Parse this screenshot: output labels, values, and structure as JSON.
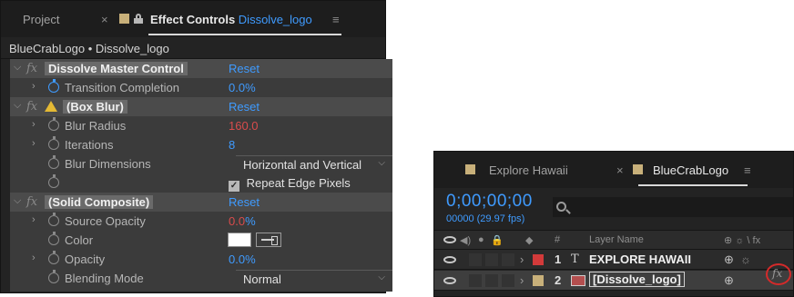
{
  "effect_controls": {
    "tab_project": "Project",
    "tab_close": "×",
    "tab_title_prefix": "Effect Controls",
    "tab_title_layer": "Dissolve_logo",
    "menu_icon": "≡",
    "breadcrumb": "BlueCrabLogo • Dissolve_logo",
    "colors": {
      "accent": "#3f9bff",
      "red_value": "#d94c4c",
      "panel": "#3b3b3b",
      "fx_row": "#4b4b4b"
    },
    "effects": [
      {
        "name": "Dissolve Master Control",
        "reset": "Reset",
        "properties": [
          {
            "name": "Transition Completion",
            "value": "0.0%",
            "stopwatch_active": true
          }
        ]
      },
      {
        "name": "(Box Blur)",
        "reset": "Reset",
        "warning": true,
        "properties": [
          {
            "name": "Blur Radius",
            "value": "160.0"
          },
          {
            "name": "Iterations",
            "value": "8"
          },
          {
            "name": "Blur Dimensions",
            "value": "Horizontal and Vertical"
          },
          {
            "name": "",
            "value": "Repeat Edge Pixels",
            "checkbox": true,
            "checked": true
          }
        ]
      },
      {
        "name": "(Solid Composite)",
        "reset": "Reset",
        "properties": [
          {
            "name": "Source Opacity",
            "value_red": "0.0",
            "value_suffix": "%"
          },
          {
            "name": "Color",
            "color": "#ffffff"
          },
          {
            "name": "Opacity",
            "value": "0.0%"
          },
          {
            "name": "Blending Mode",
            "value": "Normal"
          }
        ]
      }
    ]
  },
  "timeline": {
    "tab_inactive": "Explore Hawaii",
    "tab_close": "×",
    "tab_active": "BlueCrabLogo",
    "menu_icon": "≡",
    "timecode": "0;00;00;00",
    "fps": "00000 (29.97 fps)",
    "search_placeholder": "",
    "header": {
      "number": "#",
      "layer_name": "Layer Name",
      "switches": "⊕ ☼ \\ fx"
    },
    "layers": [
      {
        "index": "1",
        "type": "T",
        "name": "EXPLORE HAWAII",
        "label_color": "#d23a3a"
      },
      {
        "index": "2",
        "name": "[Dissolve_logo]",
        "label_color": "#c8b07a",
        "fx_icon": "fx"
      }
    ]
  }
}
